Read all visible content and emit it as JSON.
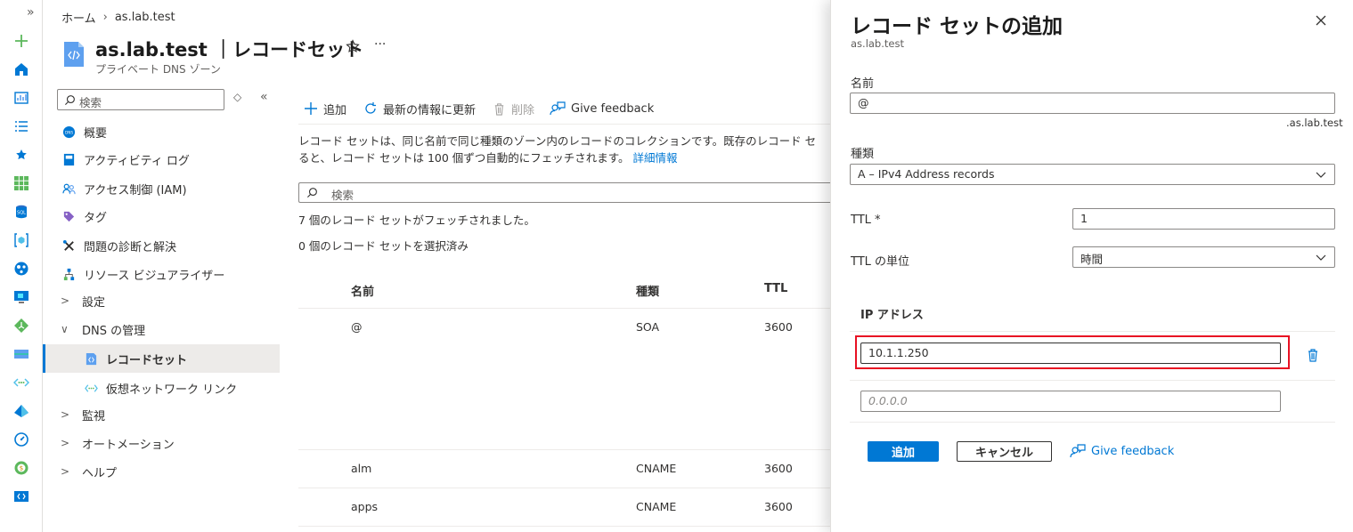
{
  "rail": {
    "collapse": "»",
    "icons": [
      "plus-icon",
      "home-icon",
      "dashboard-icon",
      "all-services-icon",
      "favorites-star-icon",
      "all-resources-icon",
      "sql-icon",
      "resource-group-icon",
      "app-services-icon",
      "virtual-machine-icon",
      "load-balancer-icon",
      "storage-icon",
      "virtual-network-icon",
      "azure-ad-icon",
      "monitor-icon",
      "cost-management-icon",
      "dns-zone-icon"
    ]
  },
  "breadcrumb": {
    "home": "ホーム",
    "separator": "›",
    "current": "as.lab.test"
  },
  "header": {
    "title": "as.lab.test ｜レコードセット",
    "subtitle": "プライベート DNS ゾーン",
    "more": "···"
  },
  "sidebar": {
    "search_placeholder": "検索",
    "items": [
      {
        "label": "概要"
      },
      {
        "label": "アクティビティ ログ"
      },
      {
        "label": "アクセス制御 (IAM)"
      },
      {
        "label": "タグ"
      },
      {
        "label": "問題の診断と解決"
      },
      {
        "label": "リソース ビジュアライザー"
      },
      {
        "label": "設定"
      },
      {
        "label": "DNS の管理"
      },
      {
        "label": "レコードセット"
      },
      {
        "label": "仮想ネットワーク リンク"
      },
      {
        "label": "監視"
      },
      {
        "label": "オートメーション"
      },
      {
        "label": "ヘルプ"
      }
    ]
  },
  "toolbar": {
    "add": "追加",
    "refresh": "最新の情報に更新",
    "delete": "削除",
    "feedback": "Give feedback"
  },
  "main": {
    "description_line1": "レコード セットは、同じ名前で同じ種類のゾーン内のレコードのコレクションです。既存のレコード セ",
    "description_line2": "ると、レコード セットは 100 個ずつ自動的にフェッチされます。",
    "learn_more": "詳細情報",
    "search_placeholder": "検索",
    "fetched": "7 個のレコード セットがフェッチされました。",
    "selected": "0 個のレコード セットを選択済み",
    "columns": {
      "name": "名前",
      "type": "種類",
      "ttl": "TTL"
    },
    "rows": [
      {
        "name": "@",
        "type": "SOA",
        "ttl": "3600"
      },
      {
        "name": "alm",
        "type": "CNAME",
        "ttl": "3600"
      },
      {
        "name": "apps",
        "type": "CNAME",
        "ttl": "3600"
      }
    ]
  },
  "panel": {
    "title": "レコード セットの追加",
    "subtitle": "as.lab.test",
    "name_label": "名前",
    "name_value": "@",
    "zone_suffix": ".as.lab.test",
    "type_label": "種類",
    "type_value": "A – IPv4 Address records",
    "ttl_label": "TTL *",
    "ttl_value": "1",
    "ttl_unit_label": "TTL の単位",
    "ttl_unit_value": "時間",
    "ip_header": "IP アドレス",
    "ip_value": "10.1.1.250",
    "ip_placeholder": "0.0.0.0",
    "add_button": "追加",
    "cancel_button": "キャンセル",
    "feedback": "Give feedback",
    "highlight_color": "#e81123"
  }
}
